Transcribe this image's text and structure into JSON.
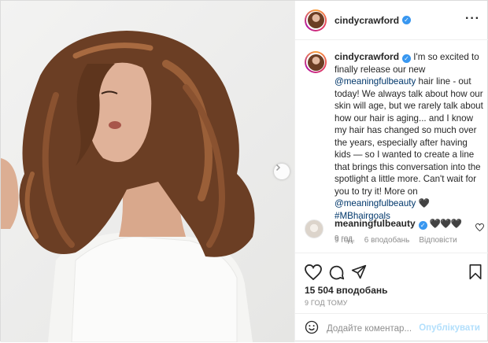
{
  "post": {
    "username": "cindycrawford",
    "caption": {
      "username": "cindycrawford",
      "part1": "I'm so excited to finally release our new ",
      "mention1": "@meaningfulbeauty",
      "part2": " hair line - out today! We always talk about how our skin will age, but we rarely talk about how our hair is aging... and I know my hair has changed so much over the years, especially after having kids — so I wanted to create a line that brings this conversation into the spotlight a little more. Can't wait for you to try it! More on ",
      "mention2": "@meaningfulbeauty",
      "part3": " 🖤 ",
      "hashtag": "#MBhairgoals",
      "time": "9 год."
    },
    "comment": {
      "username": "meaningfulbeauty",
      "text": "🖤🖤🖤",
      "time": "9 год.",
      "likes": "6 вподобань",
      "reply": "Відповісти"
    },
    "likes_count": "15 504 вподобань",
    "time_ago": "9 год тому",
    "add_comment": {
      "placeholder": "Додайте коментар...",
      "post_label": "Опублікувати"
    }
  },
  "colors": {
    "link": "#00376b",
    "verified": "#3897f0",
    "muted": "#8e8e8e",
    "post_button_disabled": "#b2dffc",
    "hair": "#6b3e24"
  },
  "icons": [
    "more-icon",
    "heart-icon",
    "comment-icon",
    "share-icon",
    "bookmark-icon",
    "emoji-icon",
    "next-arrow-icon",
    "verified-icon"
  ]
}
